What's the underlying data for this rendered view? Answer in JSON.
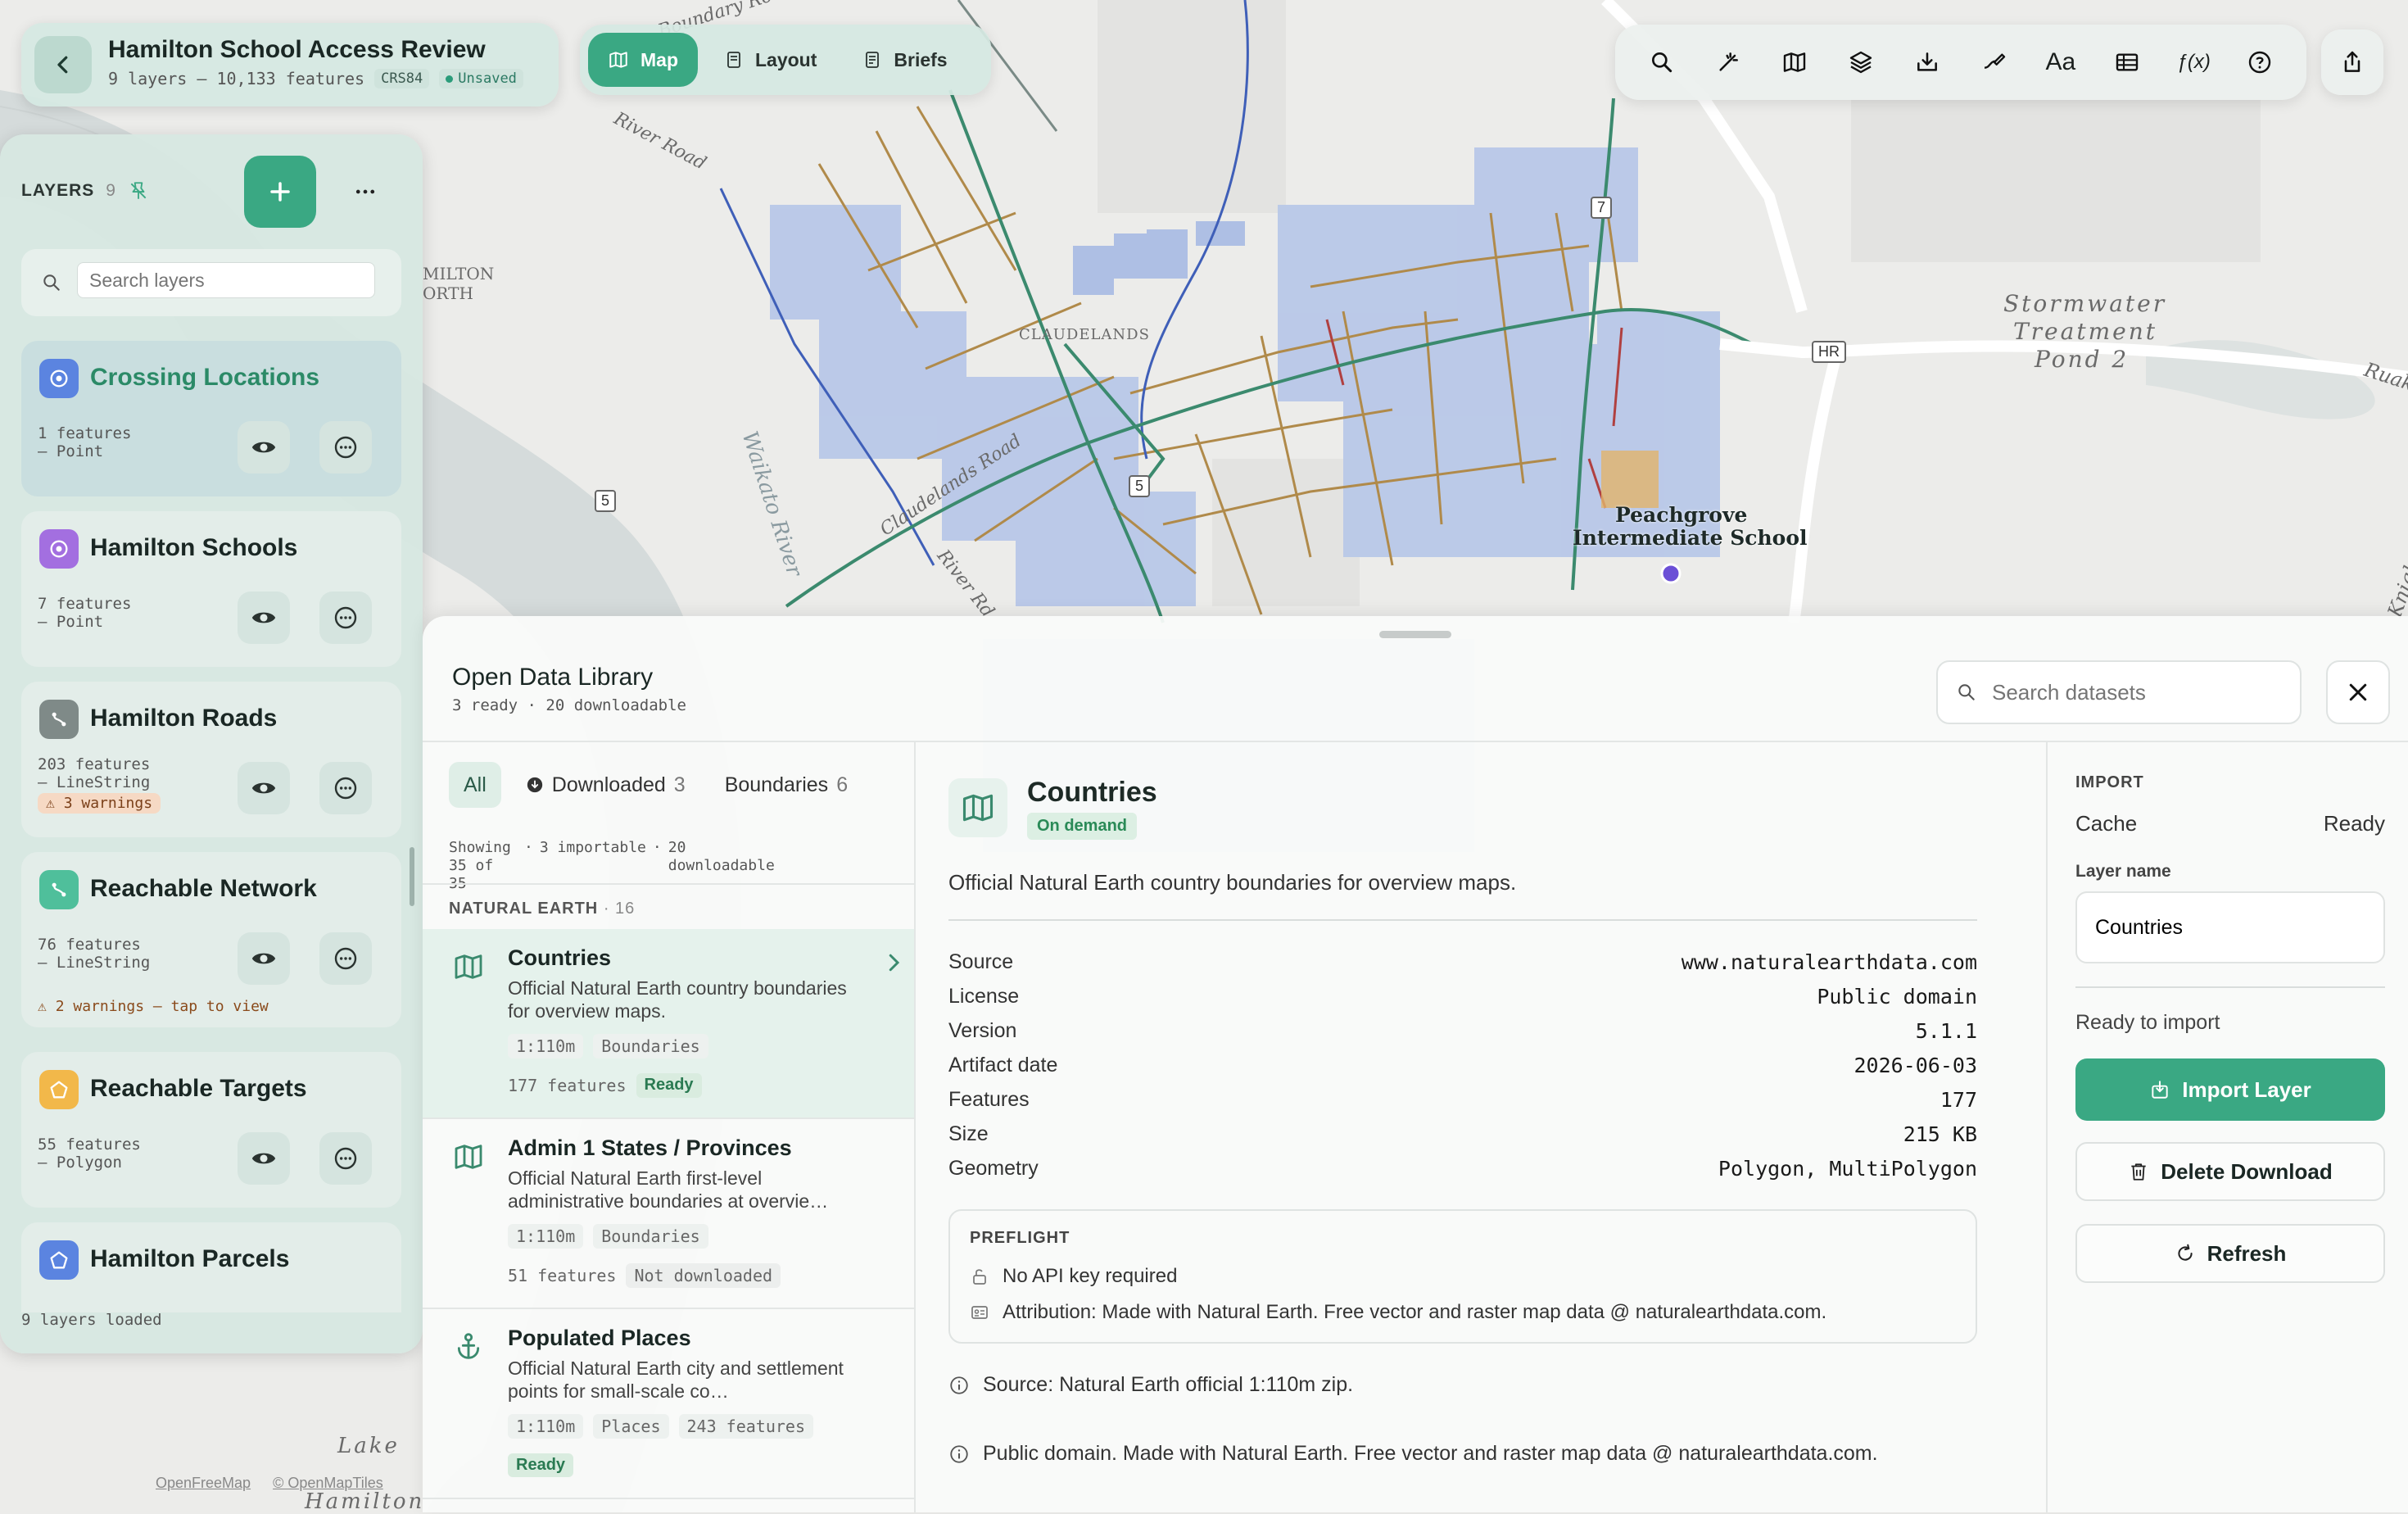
{
  "project": {
    "title": "Hamilton School Access Review",
    "summary": "9 layers – 10,133 features",
    "crs": "CRS84",
    "save_state": "Unsaved"
  },
  "view_tabs": [
    {
      "label": "Map",
      "icon": "map-icon",
      "active": true
    },
    {
      "label": "Layout",
      "icon": "layout-icon",
      "active": false
    },
    {
      "label": "Briefs",
      "icon": "briefs-icon",
      "active": false
    }
  ],
  "toolbar": {
    "icons": [
      "search-icon",
      "magic-wand-icon",
      "basemap-icon",
      "layers-icon",
      "import-icon",
      "draw-icon",
      "text-icon",
      "table-icon",
      "function-icon",
      "help-icon"
    ],
    "text_button": "Aa",
    "function_button": "ƒ(x)"
  },
  "map": {
    "labels": {
      "boundary_road": "Boundary Road",
      "river_road": "River Road",
      "claudelands": "CLAUDELANDS",
      "claudelands_road": "Claudelands Road",
      "waikato_river": "Waikato River",
      "river_rd_short": "River Rd",
      "hamilton_north_1": "MILTON",
      "hamilton_north_2": "ORTH",
      "stormwater_1": "Stormwater",
      "stormwater_2": "Treatment",
      "stormwater_3": "Pond 2",
      "school_1": "Peachgrove",
      "school_2": "Intermediate School",
      "ruak": "Ruak",
      "knight": "Knight",
      "lake_1": "Lake",
      "lake_2": "Hamilton"
    },
    "shields": {
      "s1": "7",
      "s2": "HR",
      "s3": "5",
      "s4": "5"
    },
    "attribution": [
      "OpenFreeMap",
      "© OpenMapTiles"
    ]
  },
  "layers_panel": {
    "title": "LAYERS",
    "count": "9",
    "search_placeholder": "Search layers",
    "footer": "9 layers loaded",
    "items": [
      {
        "name": "Crossing Locations",
        "meta": "1 features\n– Point",
        "icon": "point-icon",
        "color": "#5b84e0",
        "selected": true
      },
      {
        "name": "Hamilton Schools",
        "meta": "7 features\n– Point",
        "icon": "point-icon",
        "color": "#a36fe0"
      },
      {
        "name": "Hamilton Roads",
        "meta": "203 features\n– LineString",
        "icon": "line-icon",
        "color": "#7f8a88",
        "warning_badge": "3 warnings"
      },
      {
        "name": "Reachable Network",
        "meta": "76 features\n– LineString",
        "icon": "line-icon",
        "color": "#4fbf9b",
        "warning_line": "2 warnings — tap to view"
      },
      {
        "name": "Reachable Targets",
        "meta": "55 features\n– Polygon",
        "icon": "polygon-icon",
        "color": "#f2b84a"
      },
      {
        "name": "Hamilton Parcels",
        "meta": "",
        "icon": "polygon-icon",
        "color": "#5b84e0"
      }
    ]
  },
  "library": {
    "title": "Open Data Library",
    "subtitle": "3 ready · 20 downloadable",
    "search_placeholder": "Search datasets",
    "filters": [
      {
        "label": "All",
        "count": ""
      },
      {
        "label": "Downloaded",
        "count": "3"
      },
      {
        "label": "Boundaries",
        "count": "6"
      }
    ],
    "summary": [
      "Showing 35 of 35",
      "3 importable",
      "20 downloadable"
    ],
    "group": {
      "name": "NATURAL EARTH",
      "count": "16"
    },
    "datasets": [
      {
        "name": "Countries",
        "desc": "Official Natural Earth country boundaries for overview maps.",
        "scale": "1:110m",
        "category": "Boundaries",
        "features": "177 features",
        "status": "Ready",
        "icon": "map-icon"
      },
      {
        "name": "Admin 1 States / Provinces",
        "desc": "Official Natural Earth first-level administrative boundaries at overvie…",
        "scale": "1:110m",
        "category": "Boundaries",
        "features": "51 features",
        "status": "Not downloaded",
        "icon": "map-icon"
      },
      {
        "name": "Populated Places",
        "desc": "Official Natural Earth city and settlement points for small-scale co…",
        "scale": "1:110m",
        "category": "Places",
        "features": "243 features",
        "status": "Ready",
        "icon": "anchor-icon"
      }
    ]
  },
  "detail": {
    "title": "Countries",
    "badge": "On demand",
    "desc": "Official Natural Earth country boundaries for overview maps.",
    "rows": [
      {
        "k": "Source",
        "v": "www.naturalearthdata.com"
      },
      {
        "k": "License",
        "v": "Public domain"
      },
      {
        "k": "Version",
        "v": "5.1.1"
      },
      {
        "k": "Artifact date",
        "v": "2026-06-03"
      },
      {
        "k": "Features",
        "v": "177"
      },
      {
        "k": "Size",
        "v": "215 KB"
      },
      {
        "k": "Geometry",
        "v": "Polygon, MultiPolygon"
      }
    ],
    "preflight_title": "PREFLIGHT",
    "preflight": [
      "No API key required",
      "Attribution: Made with Natural Earth. Free vector and raster map data @ naturalearthdata.com."
    ],
    "notes": [
      "Source: Natural Earth official 1:110m zip.",
      "Public domain. Made with Natural Earth. Free vector and raster map data @ naturalearthdata.com."
    ]
  },
  "import": {
    "title": "IMPORT",
    "cache_label": "Cache",
    "cache_value": "Ready",
    "layer_name_label": "Layer name",
    "layer_name_value": "Countries",
    "ready_text": "Ready to import",
    "import_button": "Import Layer",
    "delete_button": "Delete Download",
    "refresh_button": "Refresh"
  }
}
